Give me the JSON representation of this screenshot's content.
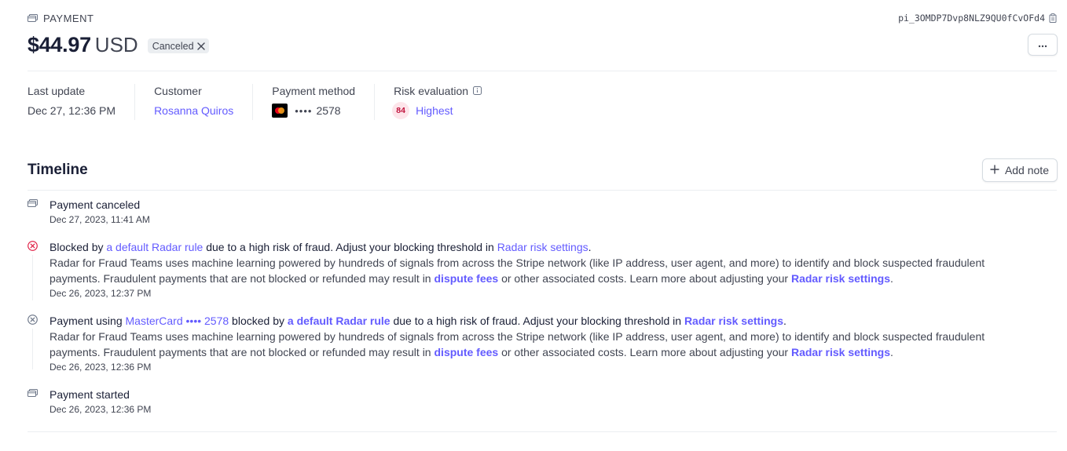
{
  "header": {
    "section_label": "PAYMENT",
    "payment_id": "pi_3OMDP7Dvp8NLZ9QU0fCvOFd4",
    "amount": "$44.97",
    "currency": "USD",
    "status_badge": "Canceled",
    "more_button": "···"
  },
  "summary": {
    "last_update": {
      "label": "Last update",
      "value": "Dec 27, 12:36 PM"
    },
    "customer": {
      "label": "Customer",
      "value": "Rosanna Quiros"
    },
    "payment_method": {
      "label": "Payment method",
      "card_dots": "••••",
      "last4": "2578",
      "brand_icon": "mastercard-icon"
    },
    "risk": {
      "label": "Risk evaluation",
      "score": "84",
      "level": "Highest"
    }
  },
  "timeline": {
    "title": "Timeline",
    "add_note": "Add note",
    "events": [
      {
        "title": "Payment canceled",
        "time": "Dec 27, 2023, 11:41 AM"
      },
      {
        "t1": "Blocked by ",
        "l1": "a default Radar rule",
        "t2": " due to a high risk of fraud. Adjust your blocking threshold in ",
        "l2": "Radar risk settings",
        "t3": ".",
        "d1": "Radar for Fraud Teams uses machine learning powered by hundreds of signals from across the Stripe network (like IP address, user agent, and more) to identify and block suspected fraudulent payments. Fraudulent payments that are not blocked or refunded may result in ",
        "dl1": "dispute fees",
        "d2": " or other associated costs. Learn more about adjusting your ",
        "dl2": "Radar risk settings",
        "d3": ".",
        "time": "Dec 26, 2023, 12:37 PM"
      },
      {
        "t1": "Payment using ",
        "l0": "MasterCard •••• 2578",
        "t1b": " blocked by ",
        "l1": "a default Radar rule",
        "t2": " due to a high risk of fraud. Adjust your blocking threshold in ",
        "l2": "Radar risk settings",
        "t3": ".",
        "d1": "Radar for Fraud Teams uses machine learning powered by hundreds of signals from across the Stripe network (like IP address, user agent, and more) to identify and block suspected fraudulent payments. Fraudulent payments that are not blocked or refunded may result in ",
        "dl1": "dispute fees",
        "d2": " or other associated costs. Learn more about adjusting your ",
        "dl2": "Radar risk settings",
        "d3": ".",
        "time": "Dec 26, 2023, 12:36 PM"
      },
      {
        "title": "Payment started",
        "time": "Dec 26, 2023, 12:36 PM"
      }
    ]
  },
  "colors": {
    "accent": "#635bff",
    "danger": "#df1b41",
    "text": "#1a1f36",
    "muted": "#414552"
  }
}
